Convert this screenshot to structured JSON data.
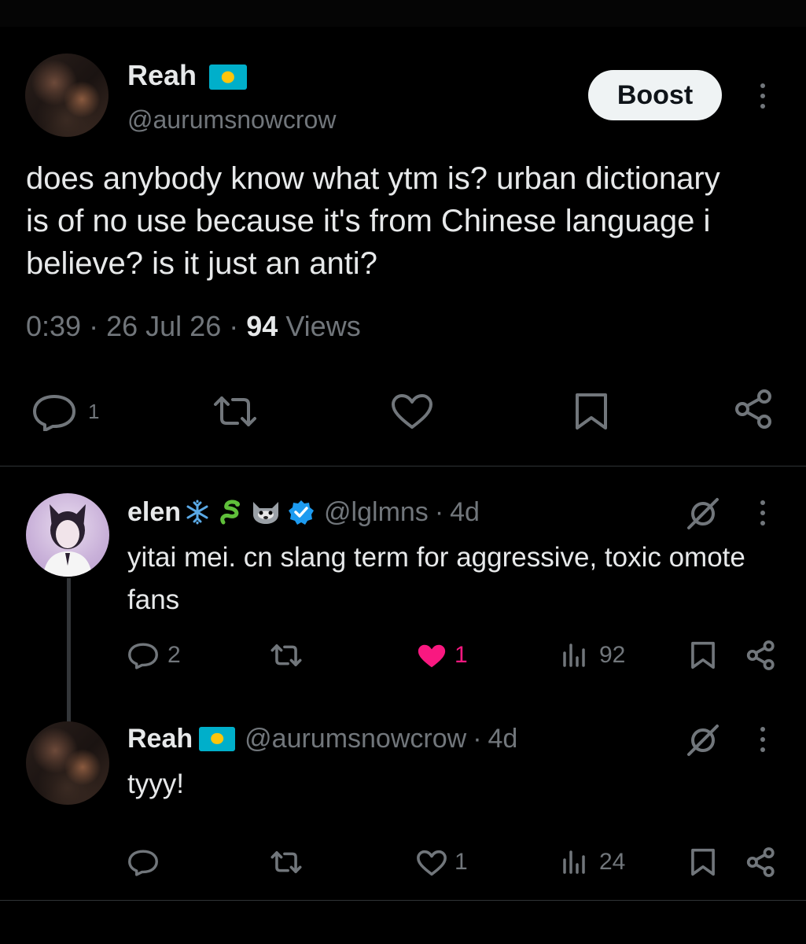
{
  "main_post": {
    "display_name": "Reah",
    "flag": "kazakhstan-flag",
    "handle": "@aurumsnowcrow",
    "boost_label": "Boost",
    "text": "does anybody know what ytm is? urban dictionary is of no use because it's from Chinese language i believe? is it just an anti?",
    "time": "0:39",
    "date": "26 Jul 26",
    "views_count": "94",
    "views_label": "Views",
    "reply_count": "1"
  },
  "reply1": {
    "display_name": "elen",
    "emojis": [
      "snowflake",
      "dragon",
      "cat-face"
    ],
    "verified": true,
    "handle": "@lglmns",
    "age": "4d",
    "text": "yitai mei. cn slang term for aggressive, toxic omote fans",
    "reply_count": "2",
    "like_count": "1",
    "liked": true,
    "view_count": "92"
  },
  "reply2": {
    "display_name": "Reah",
    "flag": "kazakhstan-flag",
    "handle": "@aurumsnowcrow",
    "age": "4d",
    "text": "tyyy!",
    "like_count": "1",
    "view_count": "24"
  },
  "colors": {
    "background": "#000000",
    "text": "#e7e9ea",
    "secondary": "#71767b",
    "like_pink": "#f91880",
    "verified_blue": "#1d9bf0",
    "flag_blue": "#00afca",
    "flag_gold": "#fec50c"
  }
}
